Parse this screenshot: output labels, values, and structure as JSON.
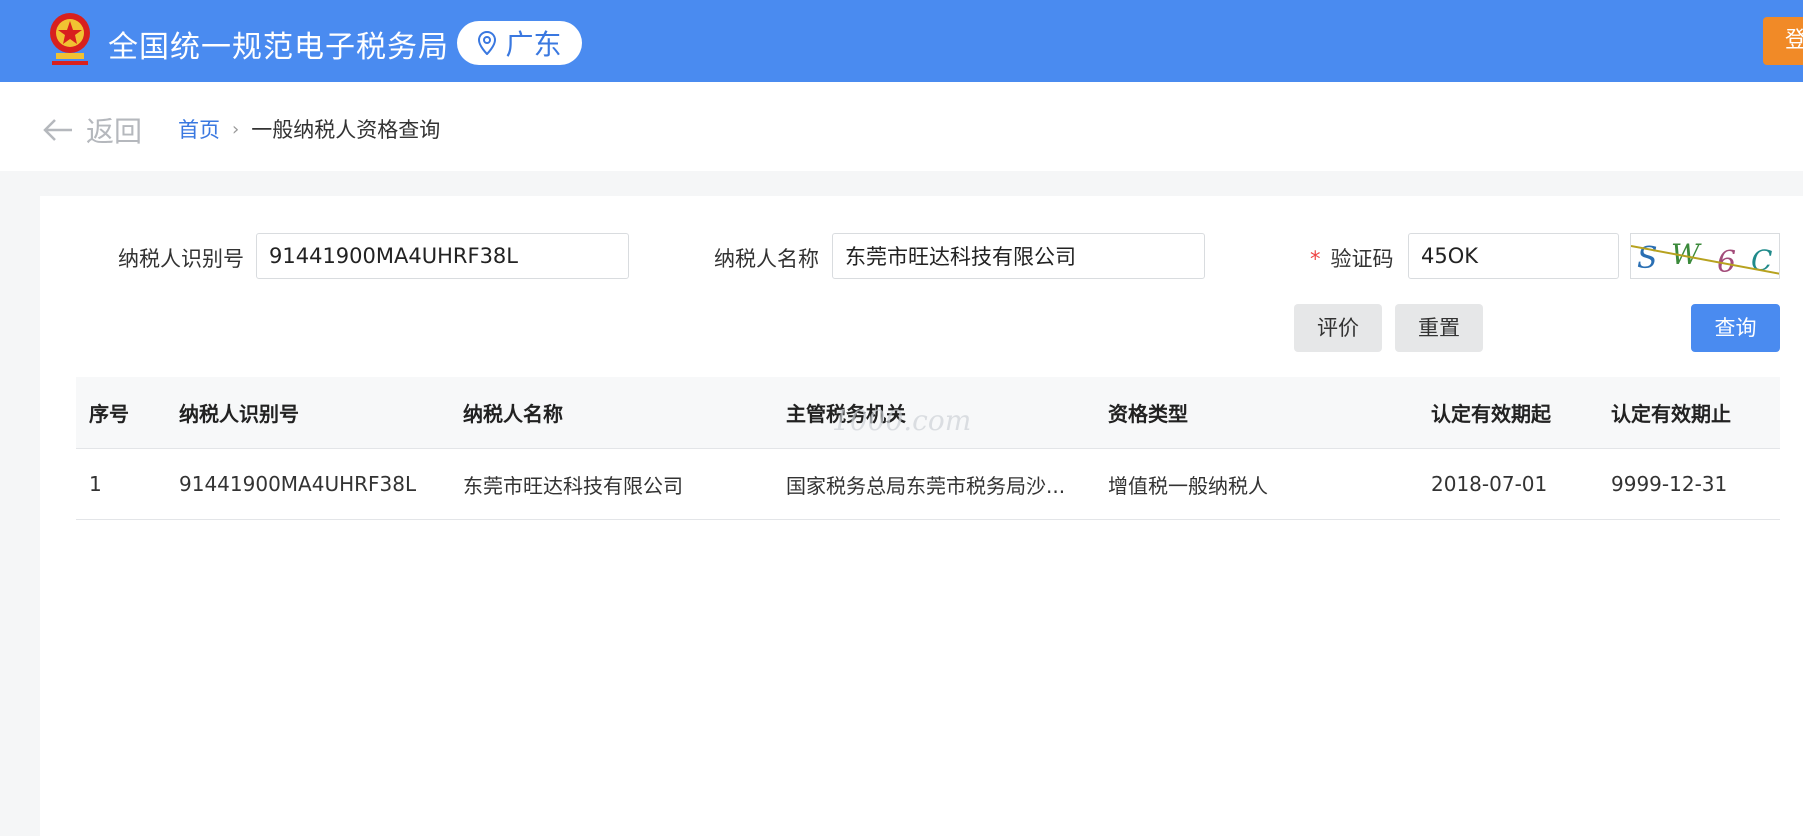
{
  "header": {
    "site_title": "全国统一规范电子税务局",
    "region": "广东",
    "login_label": "登",
    "brand_color": "#4a8bf0",
    "login_color": "#f18a27"
  },
  "nav": {
    "back_label": "返回",
    "breadcrumb": {
      "home": "首页",
      "separator": "›",
      "current": "一般纳税人资格查询"
    }
  },
  "form": {
    "taxpayer_id_label": "纳税人识别号",
    "taxpayer_id_value": "91441900MA4UHRF38L",
    "taxpayer_name_label": "纳税人名称",
    "taxpayer_name_value": "东莞市旺达科技有限公司",
    "captcha_required_mark": "*",
    "captcha_label": "验证码",
    "captcha_value": "45OK",
    "captcha_image_text": "SW6C"
  },
  "actions": {
    "evaluate": "评价",
    "reset": "重置",
    "query": "查询"
  },
  "table": {
    "columns": [
      "序号",
      "纳税人识别号",
      "纳税人名称",
      "主管税务机关",
      "资格类型",
      "认定有效期起",
      "认定有效期止"
    ],
    "rows": [
      [
        "1",
        "91441900MA4UHRF38L",
        "东莞市旺达科技有限公司",
        "国家税务总局东莞市税务局沙...",
        "增值税一般纳税人",
        "2018-07-01",
        "9999-12-31"
      ]
    ]
  },
  "watermark": "1000.com"
}
